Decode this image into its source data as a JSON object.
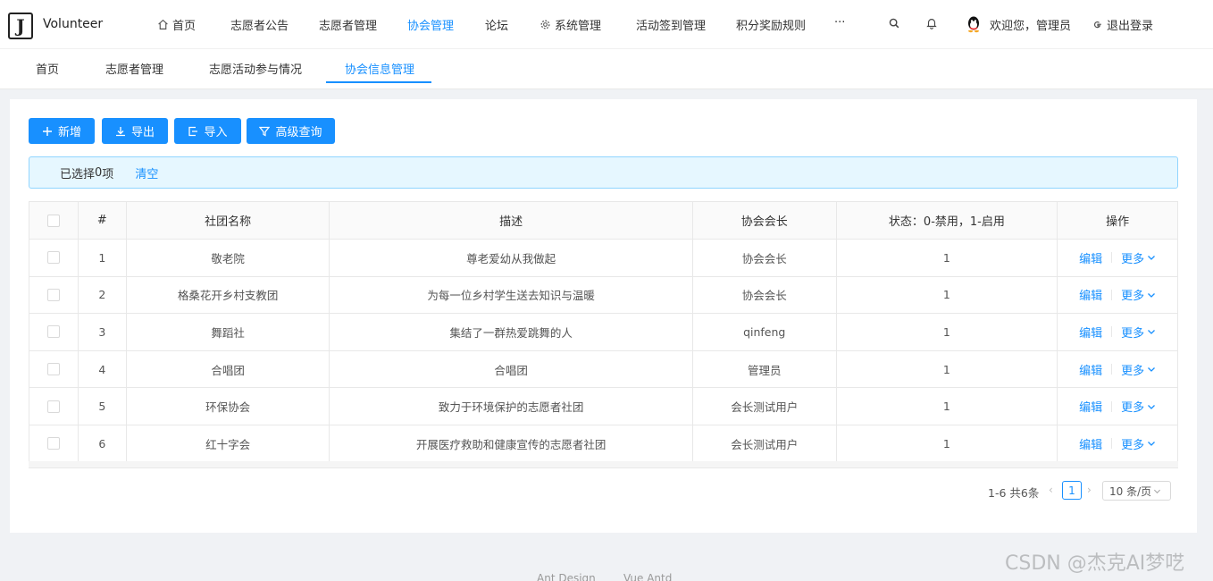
{
  "app": {
    "logo_letter": "J",
    "title": "Volunteer"
  },
  "topnav": {
    "items": [
      {
        "label": "首页",
        "icon": "home-icon"
      },
      {
        "label": "志愿者公告"
      },
      {
        "label": "志愿者管理"
      },
      {
        "label": "协会管理",
        "active": true
      },
      {
        "label": "论坛"
      },
      {
        "label": "系统管理",
        "icon": "gear-icon"
      },
      {
        "label": "活动签到管理"
      },
      {
        "label": "积分奖励规则"
      },
      {
        "label": "···"
      }
    ],
    "welcome": "欢迎您，管理员",
    "logout": "退出登录"
  },
  "tabs": [
    {
      "label": "首页"
    },
    {
      "label": "志愿者管理"
    },
    {
      "label": "志愿活动参与情况"
    },
    {
      "label": "协会信息管理",
      "active": true
    }
  ],
  "toolbar": {
    "add": "新增",
    "export": "导出",
    "import": "导入",
    "advanced": "高级查询"
  },
  "selection": {
    "text_prefix": "已选择",
    "count": "0",
    "text_suffix": "项",
    "clear": "清空"
  },
  "table": {
    "headers": [
      "#",
      "社团名称",
      "描述",
      "协会会长",
      "状态：0-禁用，1-启用",
      "操作"
    ],
    "rows": [
      {
        "no": "1",
        "name": "敬老院",
        "desc": "尊老爱幼从我做起",
        "leader": "协会会长",
        "status": "1"
      },
      {
        "no": "2",
        "name": "格桑花开乡村支教团",
        "desc": "为每一位乡村学生送去知识与温暖",
        "leader": "协会会长",
        "status": "1"
      },
      {
        "no": "3",
        "name": "舞蹈社",
        "desc": "集结了一群热爱跳舞的人",
        "leader": "qinfeng",
        "status": "1"
      },
      {
        "no": "4",
        "name": "合唱团",
        "desc": "合唱团",
        "leader": "管理员",
        "status": "1"
      },
      {
        "no": "5",
        "name": "环保协会",
        "desc": "致力于环境保护的志愿者社团",
        "leader": "会长测试用户",
        "status": "1"
      },
      {
        "no": "6",
        "name": "红十字会",
        "desc": "开展医疗救助和健康宣传的志愿者社团",
        "leader": "会长测试用户",
        "status": "1"
      }
    ],
    "edit_label": "编辑",
    "more_label": "更多"
  },
  "pagination": {
    "total": "1-6 共6条",
    "current": "1",
    "page_size": "10 条/页"
  },
  "footer": {
    "left": "Ant Design",
    "right": "Vue Antd"
  },
  "watermark": "CSDN @杰克AI梦呓",
  "colors": {
    "primary": "#1890ff",
    "alert_bg": "#e6f7ff"
  }
}
